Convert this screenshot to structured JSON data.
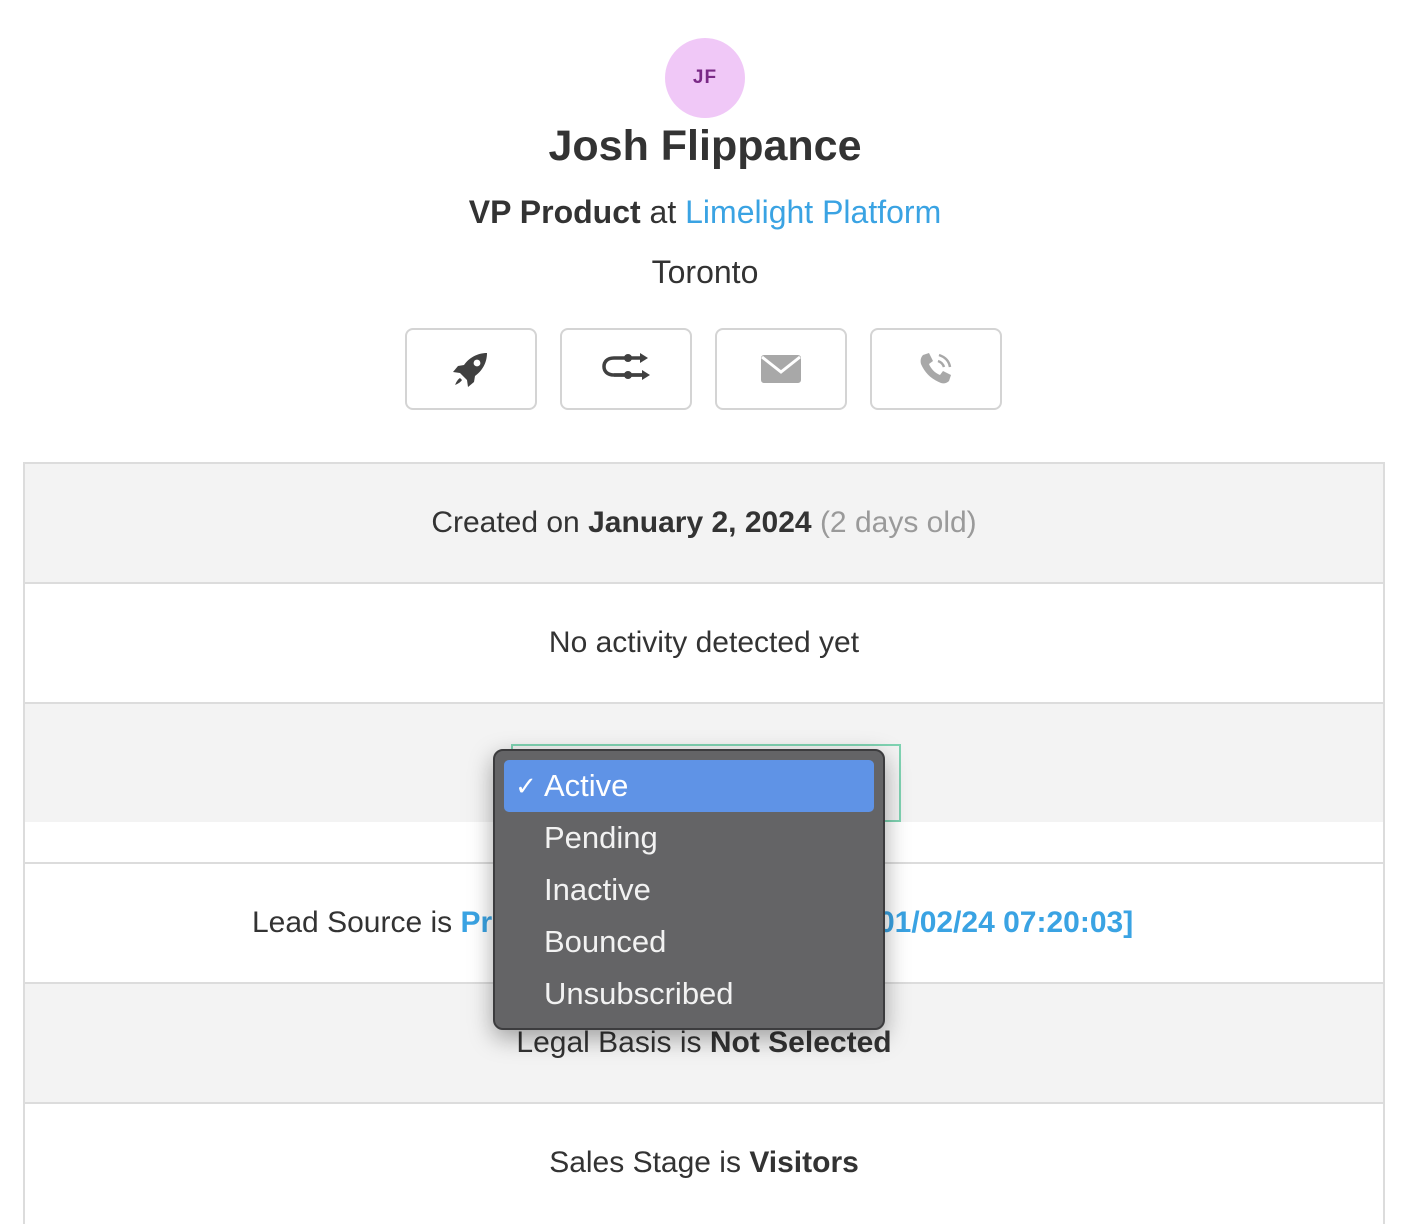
{
  "contact": {
    "initials": "JF",
    "name": "Josh Flippance",
    "title": "VP Product",
    "at": "at",
    "company": "Limelight Platform",
    "city": "Toronto"
  },
  "actions": [
    {
      "icon": "rocket-icon"
    },
    {
      "icon": "workflow-icon"
    },
    {
      "icon": "envelope-icon"
    },
    {
      "icon": "phone-icon"
    }
  ],
  "rows": {
    "created": {
      "prefix": "Created on",
      "date": "January 2, 2024",
      "age": "(2 days old)"
    },
    "activity": {
      "text": "No activity detected yet"
    },
    "lead_source": {
      "prefix": "Lead Source is",
      "value_start": "Pr",
      "value_end": "01/02/24 07:20:03]"
    },
    "legal_basis": {
      "prefix": "Legal Basis is",
      "value": "Not Selected"
    },
    "sales_stage": {
      "prefix": "Sales Stage is",
      "value": "Visitors"
    }
  },
  "status_dropdown": {
    "check_mark": "✓",
    "options": [
      "Active",
      "Pending",
      "Inactive",
      "Bounced",
      "Unsubscribed"
    ],
    "selected": "Active"
  },
  "colors": {
    "link": "#3aa3e3",
    "avatar_bg": "#f0c8f7",
    "avatar_text": "#7a2a86",
    "dropdown_bg": "#646466",
    "dropdown_selected": "#5f93e6",
    "select_border": "#7fd3b2"
  }
}
